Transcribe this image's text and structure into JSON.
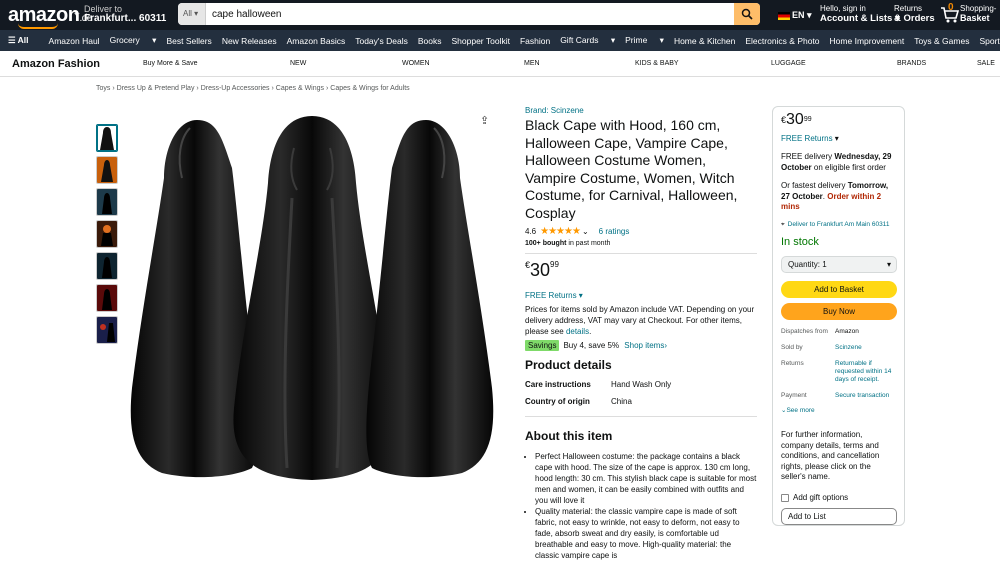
{
  "header": {
    "logo": "amazon",
    "logo_tld": ".de",
    "deliver_to_label": "Deliver to",
    "deliver_to_location": "Frankfurt... 60311",
    "search_category": "All",
    "search_value": "cape halloween",
    "language": "EN",
    "account_greeting": "Hello, sign in",
    "account_label": "Account & Lists",
    "returns_label": "Returns",
    "orders_label": "& Orders",
    "cart_count": "0",
    "cart_label": "Shopping-",
    "cart_label2": "Basket"
  },
  "nav": {
    "all": "All",
    "items": [
      "Amazon Haul",
      "Grocery",
      "Best Sellers",
      "New Releases",
      "Amazon Basics",
      "Today's Deals",
      "Books",
      "Shopper Toolkit",
      "Fashion",
      "Gift Cards",
      "Prime",
      "Home & Kitchen",
      "Electronics & Photo",
      "Home Improvement",
      "Toys & Games",
      "Sports & Outdoors"
    ]
  },
  "subnav": {
    "brand": "Amazon Fashion",
    "items": [
      "Buy More & Save",
      "NEW",
      "WOMEN",
      "MEN",
      "KIDS & BABY",
      "LUGGAGE",
      "BRANDS",
      "SALE"
    ]
  },
  "breadcrumb": [
    "Toys",
    "Dress Up & Pretend Play",
    "Dress-Up Accessories",
    "Capes & Wings",
    "Capes & Wings for Adults"
  ],
  "product": {
    "brand": "Brand: Scinzene",
    "title": "Black Cape with Hood, 160 cm, Halloween Cape, Vampire Cape, Halloween Costume Women, Vampire Costume, Women, Witch Costume, for Carnival, Halloween, Cosplay",
    "rating": "4.6",
    "rating_stars": 4.6,
    "ratings_count": "6 ratings",
    "bought_bold": "100+ bought",
    "bought_rest": "in past month",
    "currency": "€",
    "price_whole": "30",
    "price_fraction": "99",
    "free_returns": "FREE Returns",
    "vat_text": "Prices for items sold by Amazon include VAT. Depending on your delivery address, VAT may vary at Checkout. For other items, please see",
    "vat_link": "details",
    "savings_tag": "Savings",
    "savings_text": "Buy 4, save 5%",
    "savings_link": "Shop items",
    "details_heading": "Product details",
    "details": [
      {
        "k": "Care instructions",
        "v": "Hand Wash Only"
      },
      {
        "k": "Country of origin",
        "v": "China"
      }
    ],
    "about_heading": "About this item",
    "bullets": [
      "Perfect Halloween costume: the package contains a black cape with hood. The size of the cape is approx. 130 cm long, hood length: 30 cm. This stylish black cape is suitable for most men and women, it can be easily combined with outfits and you will love it",
      "Quality material: the classic vampire cape is made of soft fabric, not easy to wrinkle, not easy to deform, not easy to fade, absorb sweat and dry easily, is comfortable ud breathable and easy to move. High-quality material: the classic vampire cape is"
    ]
  },
  "buybox": {
    "currency": "€",
    "price_whole": "30",
    "price_fraction": "99",
    "free_returns": "FREE Returns",
    "delivery_pre": "FREE delivery",
    "delivery_date": "Wednesday, 29 October",
    "delivery_post": "on eligible first order",
    "fastest_pre": "Or fastest delivery",
    "fastest_date": "Tomorrow, 27 October",
    "order_within": "Order within 2 mins",
    "deliver_link": "Deliver to Frankfurt Am Main 60311",
    "stock": "In stock",
    "quantity": "Quantity: 1",
    "add_basket": "Add to Basket",
    "buy_now": "Buy Now",
    "info": [
      {
        "k": "Dispatches from",
        "v": "Amazon",
        "link": false
      },
      {
        "k": "Sold by",
        "v": "Scinzene",
        "link": true
      },
      {
        "k": "Returns",
        "v": "Returnable if requested within 14 days of receipt.",
        "link": true
      },
      {
        "k": "Payment",
        "v": "Secure transaction",
        "link": true
      }
    ],
    "see_more": "See more",
    "further": "For further information, company details, terms and conditions, and cancellation rights, please click on the seller's name.",
    "gift": "Add gift options",
    "add_list": "Add to List"
  }
}
